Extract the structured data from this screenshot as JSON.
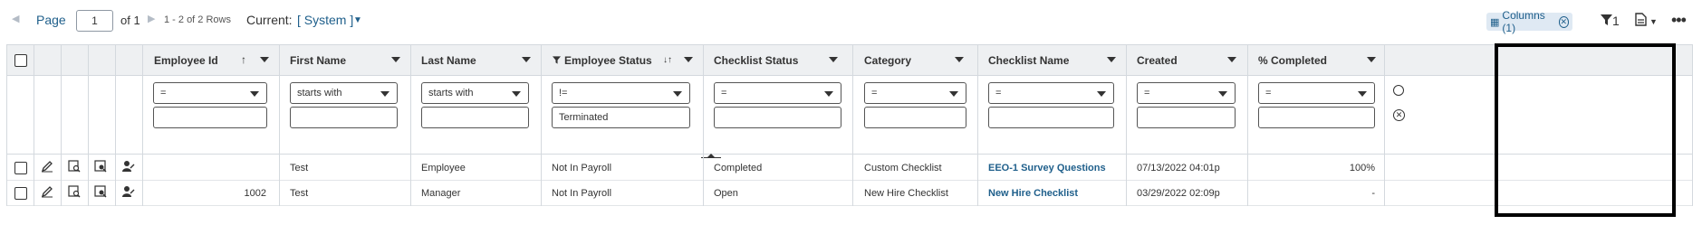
{
  "pager": {
    "page_label": "Page",
    "page_value": "1",
    "of_label": "of 1",
    "rows_label": "1 - 2 of 2 Rows"
  },
  "view": {
    "current_label": "Current:",
    "current_value": "[ System ]"
  },
  "toolbar": {
    "columns_chip": "Columns (1)",
    "filter_count": "1"
  },
  "columns": [
    {
      "id": "employee_id",
      "label": "Employee Id",
      "sort": "asc"
    },
    {
      "id": "first_name",
      "label": "First Name"
    },
    {
      "id": "last_name",
      "label": "Last Name"
    },
    {
      "id": "employee_status",
      "label": "Employee Status",
      "filtered": true
    },
    {
      "id": "checklist_status",
      "label": "Checklist Status"
    },
    {
      "id": "category",
      "label": "Category"
    },
    {
      "id": "checklist_name",
      "label": "Checklist Name"
    },
    {
      "id": "created",
      "label": "Created"
    },
    {
      "id": "pct_completed",
      "label": "% Completed"
    }
  ],
  "filters": {
    "employee_id": {
      "operator": "=",
      "value": ""
    },
    "first_name": {
      "operator": "starts with",
      "value": ""
    },
    "last_name": {
      "operator": "starts with",
      "value": ""
    },
    "employee_status": {
      "operator": "!=",
      "value": "Terminated"
    },
    "checklist_status": {
      "operator": "=",
      "value": ""
    },
    "category": {
      "operator": "=",
      "value": ""
    },
    "checklist_name": {
      "operator": "=",
      "value": ""
    },
    "created": {
      "operator": "=",
      "value": ""
    },
    "pct_completed": {
      "operator": "=",
      "value": ""
    }
  },
  "rows": [
    {
      "employee_id": "",
      "first_name": "Test",
      "last_name": "Employee",
      "employee_status": "Not In Payroll",
      "checklist_status": "Completed",
      "category": "Custom Checklist",
      "checklist_name": "EEO-1 Survey Questions",
      "created": "07/13/2022 04:01p",
      "pct_completed": "100%"
    },
    {
      "employee_id": "1002",
      "first_name": "Test",
      "last_name": "Manager",
      "employee_status": "Not In Payroll",
      "checklist_status": "Open",
      "category": "New Hire Checklist",
      "checklist_name": "New Hire Checklist",
      "created": "03/29/2022 02:09p",
      "pct_completed": "-"
    }
  ],
  "icons": [
    "prev-page-icon",
    "next-page-icon",
    "caret-down-icon",
    "columns-icon",
    "clear-icon",
    "filter-icon",
    "export-icon",
    "more-icon",
    "edit-icon",
    "view-details-icon",
    "open-record-icon",
    "assign-user-icon"
  ],
  "colors": {
    "accent": "#1f5f8b",
    "header_bg": "#eef0f2",
    "chip_bg": "#dfe9f3",
    "border": "#d4d9de"
  }
}
